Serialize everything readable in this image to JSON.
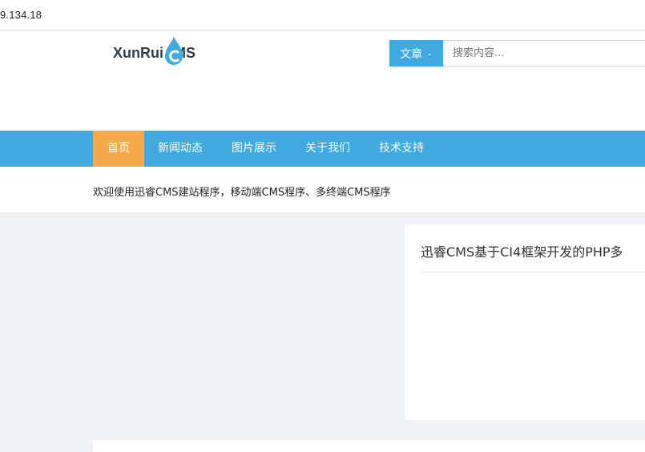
{
  "browser": {
    "address_text": "9.134.18"
  },
  "logo": {
    "text": "XunRuiCMS"
  },
  "search": {
    "category_label": "文章",
    "placeholder": "搜索内容..."
  },
  "nav": {
    "items": [
      {
        "label": "首页",
        "active": true
      },
      {
        "label": "新闻动态"
      },
      {
        "label": "图片展示"
      },
      {
        "label": "关于我们"
      },
      {
        "label": "技术支持"
      }
    ]
  },
  "notice": {
    "text": "欢迎使用迅睿CMS建站程序，移动端CMS程序、多终端CMS程序"
  },
  "feature": {
    "title": "迅睿CMS基于CI4框架开发的PHP多"
  },
  "colors": {
    "primary": "#3fa9e0",
    "active_nav": "#f5a94a",
    "page_bg": "#eef1f5",
    "logo_text": "#2f3d4d"
  }
}
